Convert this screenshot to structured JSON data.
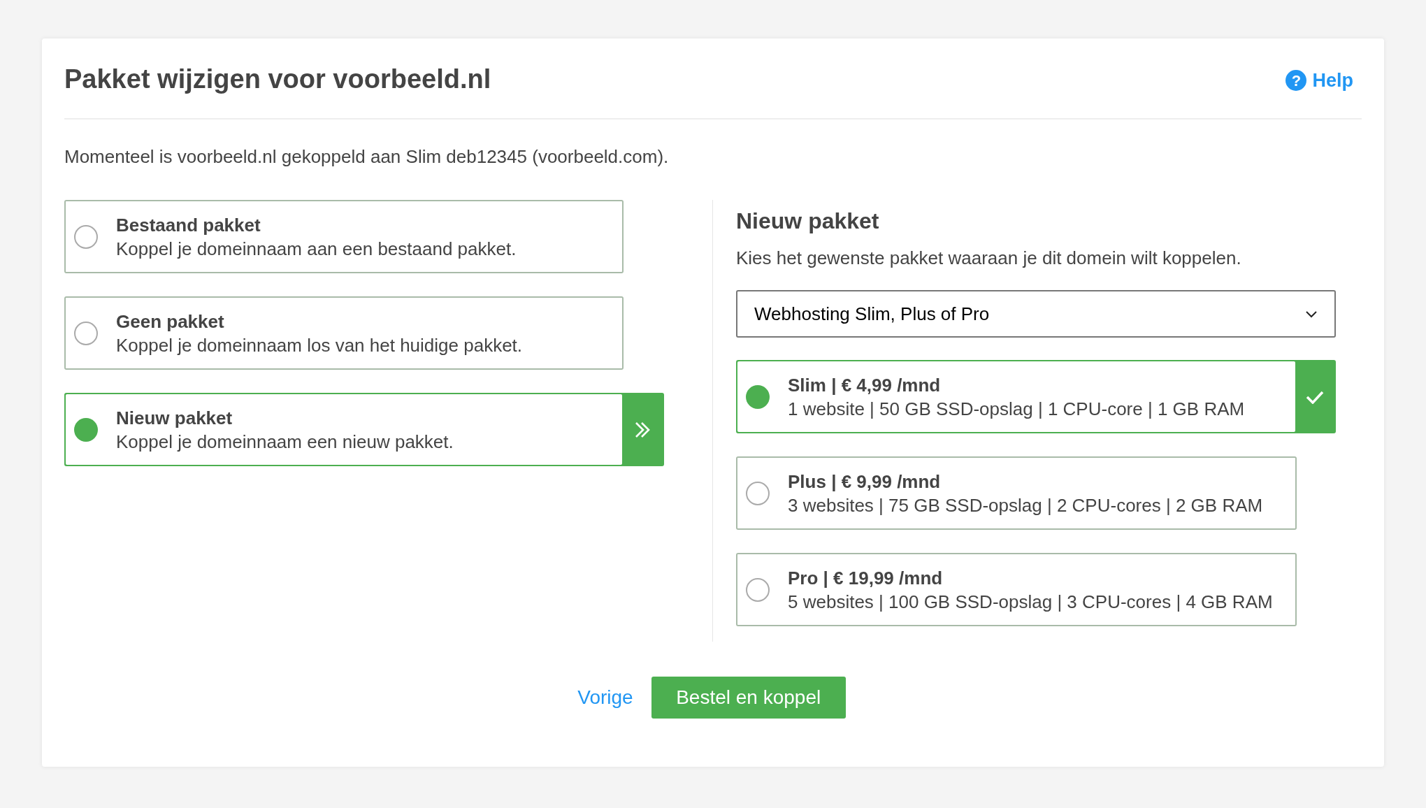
{
  "dialog": {
    "title": "Pakket wijzigen voor voorbeeld.nl",
    "help": {
      "icon": "?",
      "label": "Help"
    },
    "intro": "Momenteel is voorbeeld.nl gekoppeld aan Slim deb12345 (voorbeeld.com)."
  },
  "options": [
    {
      "title": "Bestaand pakket",
      "description": "Koppel je domeinnaam aan een bestaand pakket.",
      "selected": false
    },
    {
      "title": "Geen pakket",
      "description": "Koppel je domeinnaam los van het huidige pakket.",
      "selected": false
    },
    {
      "title": "Nieuw pakket",
      "description": "Koppel je domeinnaam een nieuw pakket.",
      "selected": true
    }
  ],
  "new_package": {
    "heading": "Nieuw pakket",
    "subtitle": "Kies het gewenste pakket waaraan je dit domein wilt koppelen.",
    "select": {
      "value": "Webhosting Slim, Plus of Pro"
    },
    "packages": [
      {
        "title": "Slim | € 4,99 /mnd",
        "specs": "1 website | 50 GB SSD-opslag | 1 CPU-core | 1 GB RAM",
        "selected": true
      },
      {
        "title": "Plus | € 9,99 /mnd",
        "specs": "3 websites | 75 GB SSD-opslag | 2 CPU-cores | 2 GB RAM",
        "selected": false
      },
      {
        "title": "Pro | € 19,99 /mnd",
        "specs": "5 websites | 100 GB SSD-opslag | 3 CPU-cores | 4 GB RAM",
        "selected": false
      }
    ]
  },
  "footer": {
    "back_link": "Vorige",
    "submit_button": "Bestel en koppel"
  }
}
